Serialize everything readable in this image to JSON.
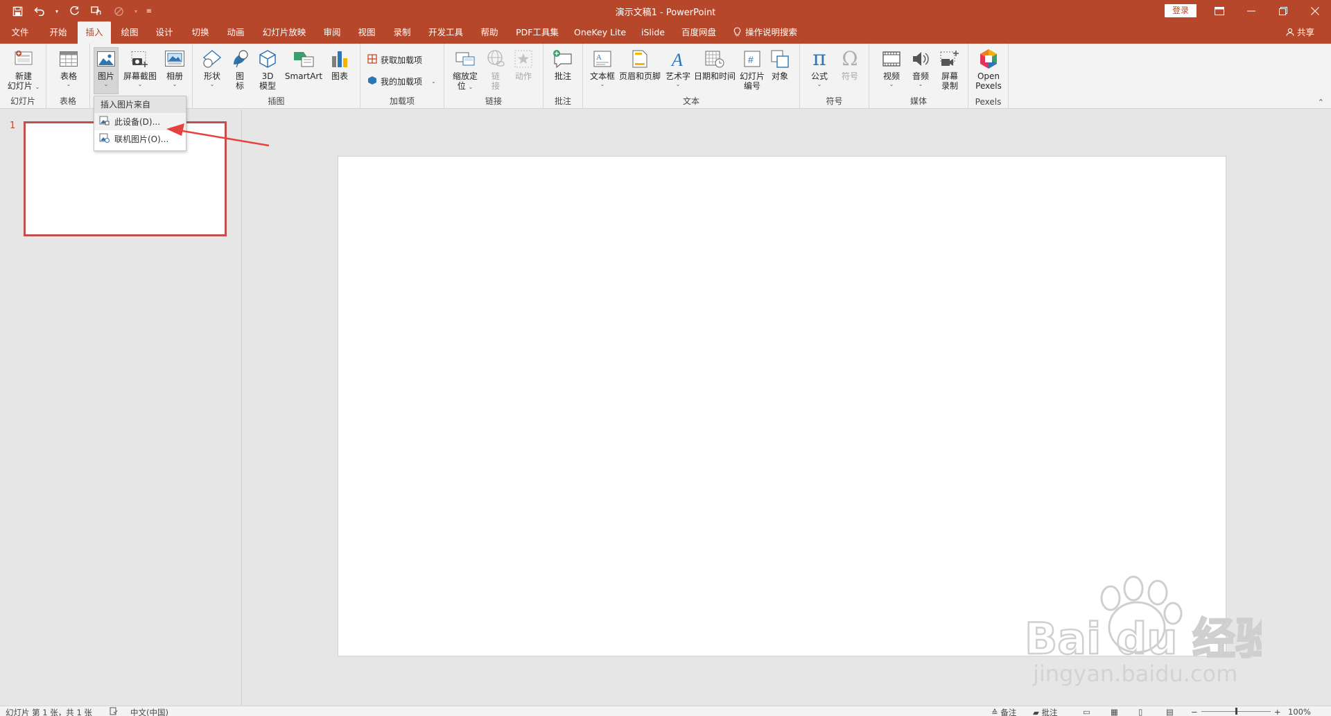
{
  "window": {
    "title": "演示文稿1 - PowerPoint",
    "login_label": "登录",
    "controls": [
      "ribbon-display-icon",
      "minimize-icon",
      "restore-icon",
      "close-icon"
    ]
  },
  "qat": {
    "items": [
      "save-icon",
      "undo-icon",
      "redo-icon",
      "touch-mode-icon",
      "format-painter-icon",
      "customize-icon"
    ]
  },
  "tabs": {
    "items": [
      "文件",
      "开始",
      "插入",
      "绘图",
      "设计",
      "切换",
      "动画",
      "幻灯片放映",
      "审阅",
      "视图",
      "录制",
      "开发工具",
      "帮助",
      "PDF工具集",
      "OneKey Lite",
      "iSlide",
      "百度网盘"
    ],
    "active": "插入",
    "tell_me": "操作说明搜索",
    "share": "共享"
  },
  "ribbon": {
    "slides": {
      "label": "幻灯片",
      "new_slide_1": "新建",
      "new_slide_2": "幻灯片"
    },
    "tables": {
      "label": "表格",
      "table": "表格"
    },
    "images": {
      "picture": "图片",
      "screenshot": "屏幕截图",
      "album": "相册"
    },
    "illustrations": {
      "label": "插图",
      "shapes": "形状",
      "icons_1": "图",
      "icons_2": "标",
      "model_1": "3D",
      "model_2": "模型",
      "smartart": "SmartArt",
      "chart": "图表"
    },
    "addins": {
      "label": "加载项",
      "get": "获取加载项",
      "mine": "我的加载项"
    },
    "links": {
      "label": "链接",
      "zoom_1": "缩放定",
      "zoom_2": "位",
      "link_1": "链",
      "link_2": "接",
      "action": "动作"
    },
    "comments": {
      "label": "批注",
      "comment": "批注"
    },
    "text": {
      "label": "文本",
      "textbox": "文本框",
      "header_footer": "页眉和页脚",
      "wordart": "艺术字",
      "datetime": "日期和时间",
      "slidenum_1": "幻灯片",
      "slidenum_2": "编号",
      "object": "对象"
    },
    "symbols": {
      "label": "符号",
      "equation": "公式",
      "symbol": "符号"
    },
    "media": {
      "label": "媒体",
      "video": "视频",
      "audio": "音频",
      "record_1": "屏幕",
      "record_2": "录制"
    },
    "pexels": {
      "label": "Pexels",
      "open_1": "Open",
      "open_2": "Pexels"
    }
  },
  "dropdown": {
    "header": "插入图片来自",
    "items": [
      "此设备(D)...",
      "联机图片(O)..."
    ]
  },
  "slides_panel": {
    "slide_number": "1"
  },
  "statusbar": {
    "slide_info": "幻灯片 第 1 张，共 1 张",
    "language": "中文(中国)",
    "notes": "备注",
    "comments": "批注",
    "zoom": "100%",
    "zoom_level": 0.5
  },
  "watermark": {
    "brand": "Bai du 经验",
    "url": "jingyan.baidu.com"
  },
  "colors": {
    "accent": "#b7472a",
    "selection": "#c0504d",
    "arrow": "#e8403c"
  }
}
